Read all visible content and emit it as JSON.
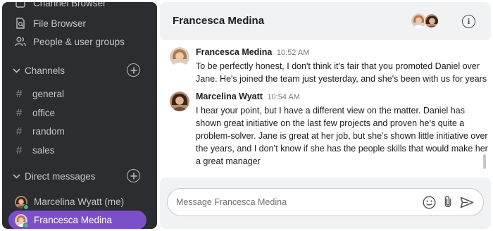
{
  "sidebar": {
    "cut_item": "Channel Browser",
    "file_browser": "File Browser",
    "people_groups": "People & user groups",
    "channels_label": "Channels",
    "channels": [
      "general",
      "office",
      "random",
      "sales"
    ],
    "dm_label": "Direct messages",
    "dms": [
      {
        "name": "Marcelina Wyatt (me)",
        "active": false
      },
      {
        "name": "Francesca Medina",
        "active": true
      }
    ],
    "active_color": "#7b4fc9"
  },
  "header": {
    "title": "Francesca Medina",
    "info_glyph": "i"
  },
  "messages": [
    {
      "author": "Francesca Medina",
      "time": "10:52 AM",
      "text": "To be perfectly honest, I don't think it's fair that you promoted Daniel over Jane. He's joined the team just yesterday, and she's been with us for years"
    },
    {
      "author": "Marcelina Wyatt",
      "time": "10:54 AM",
      "text": "I hear your point, but I have a different view on the matter. Daniel has shown great initiative on the last few projects and proven he’s quite a problem-solver. Jane is great at her job, but she’s shown little initiative over the years, and I don’t know if she has the people skills that would make her a great manager"
    }
  ],
  "composer": {
    "placeholder": "Message Francesca Medina",
    "value": ""
  },
  "icons": {
    "file_browser": "file-search-icon",
    "people": "people-icon",
    "emoji": "emoji-icon",
    "attach": "paperclip-icon",
    "send": "send-icon"
  }
}
